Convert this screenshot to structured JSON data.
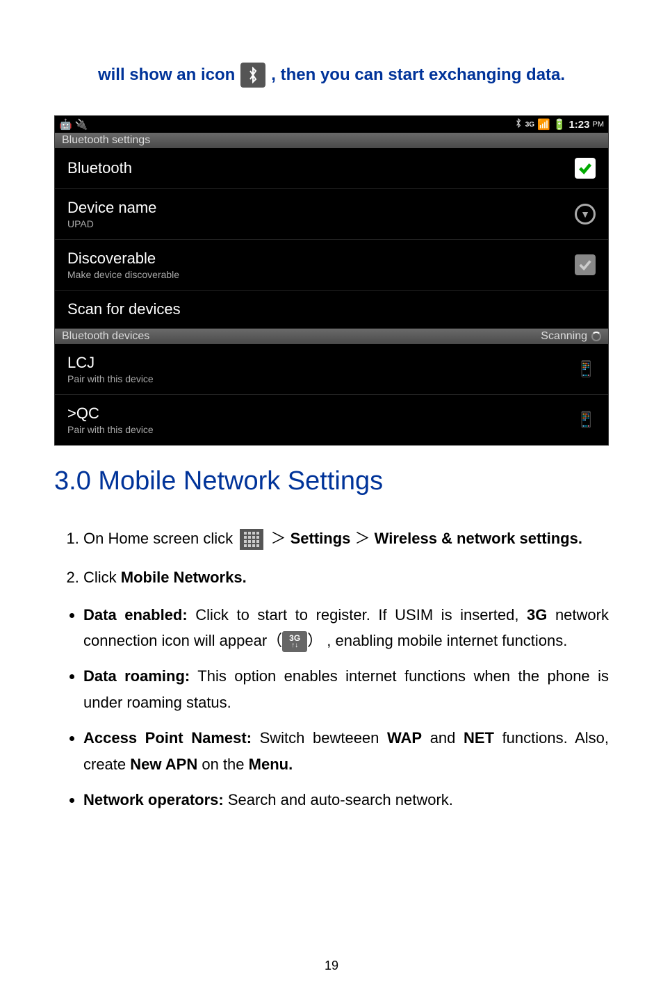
{
  "intro": {
    "part1": "will show an icon",
    "part2": ", then you can start exchanging data."
  },
  "statusbar": {
    "time": "1:23",
    "ampm": "PM"
  },
  "settings": {
    "header1": "Bluetooth settings",
    "bluetooth": "Bluetooth",
    "devicename_label": "Device name",
    "devicename_value": "UPAD",
    "discoverable_label": "Discoverable",
    "discoverable_sub": "Make device discoverable",
    "scan": "Scan for devices",
    "header2": "Bluetooth devices",
    "scanning": "Scanning",
    "devices": [
      {
        "name": "LCJ",
        "sub": "Pair with this device"
      },
      {
        "name": ">QC",
        "sub": "Pair with this device"
      }
    ]
  },
  "section_title": "3.0 Mobile Network Settings",
  "steps": {
    "s1a": "On Home screen click",
    "s1b": "Settings",
    "s1c": "Wireless & network settings.",
    "gt": "＞",
    "s2a": "Click ",
    "s2b": "Mobile Networks."
  },
  "bullets": {
    "b1_label": "Data enabled:",
    "b1_text": " Click to start to register. If USIM is inserted, ",
    "b1_bold3g": "3G",
    "b1_text2": " network connection icon will appear（",
    "b1_text3": "） , enabling mobile internet functions.",
    "b2_label": "Data roaming:",
    "b2_text": " This option enables internet functions when the phone is under roaming status.",
    "b3_label": "Access Point Namest:",
    "b3_text1": " Switch bewteeen ",
    "b3_wap": "WAP",
    "b3_and": " and ",
    "b3_net": "NET",
    "b3_text2": " functions. Also, create ",
    "b3_newapn": "New APN",
    "b3_text3": " on the ",
    "b3_menu": "Menu.",
    "b4_label": "Network operators:",
    "b4_text": " Search and auto-search network."
  },
  "pagenum": "19",
  "three_g_label": "3G"
}
